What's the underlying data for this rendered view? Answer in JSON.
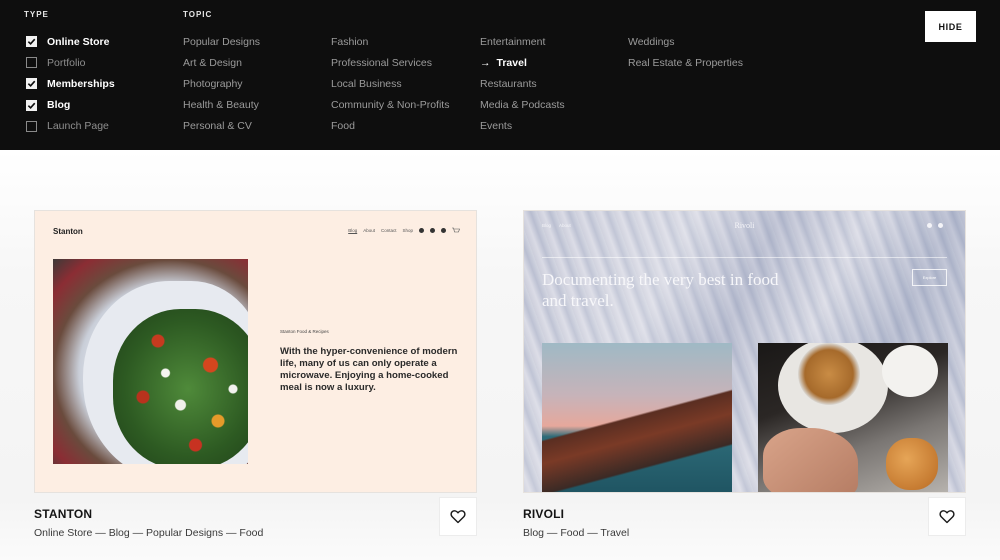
{
  "filters": {
    "type": {
      "heading": "TYPE",
      "items": [
        {
          "label": "Online Store",
          "checked": true
        },
        {
          "label": "Portfolio",
          "checked": false
        },
        {
          "label": "Memberships",
          "checked": true
        },
        {
          "label": "Blog",
          "checked": true
        },
        {
          "label": "Launch Page",
          "checked": false
        }
      ]
    },
    "topic": {
      "heading": "TOPIC",
      "columns": [
        [
          "Popular Designs",
          "Art & Design",
          "Photography",
          "Health & Beauty",
          "Personal & CV"
        ],
        [
          "Fashion",
          "Professional Services",
          "Local Business",
          "Community & Non-Profits",
          "Food"
        ],
        [
          "Entertainment",
          "Travel",
          "Restaurants",
          "Media & Podcasts",
          "Events"
        ],
        [
          "Weddings",
          "Real Estate & Properties"
        ]
      ],
      "selected": "Travel",
      "selected_icon": "arrow-right-icon",
      "selected_glyph": "→"
    },
    "hide_label": "HIDE"
  },
  "templates": [
    {
      "name": "STANTON",
      "tags": "Online Store — Blog — Popular Designs — Food",
      "favorite_icon": "heart-outline-icon",
      "preview": {
        "logo": "Stanton",
        "nav": [
          "Blog",
          "About",
          "Contact",
          "Shop"
        ],
        "kicker": "Stanton Food & Recipes",
        "quote": "With the hyper-convenience of modern life, many of us can only operate a microwave. Enjoying a home-cooked meal is now a luxury.",
        "bg_color": "#fdeee3"
      }
    },
    {
      "name": "RIVOLI",
      "tags": "Blog — Food — Travel",
      "favorite_icon": "heart-outline-icon",
      "preview": {
        "logo": "Rivoli",
        "nav": [
          "Blog",
          "About"
        ],
        "headline": "Documenting the very best in food and travel.",
        "button": "Explore"
      }
    }
  ]
}
